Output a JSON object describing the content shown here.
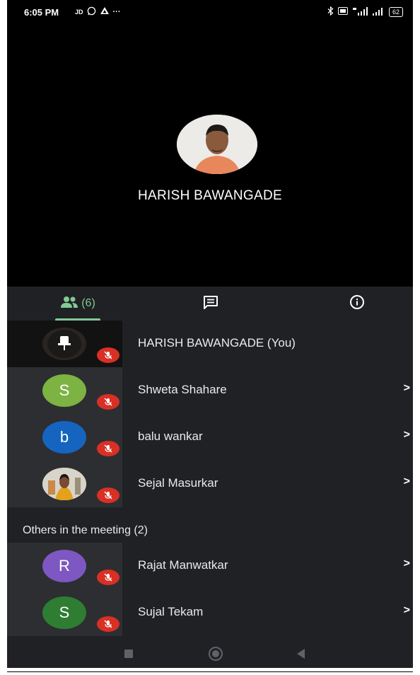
{
  "status_bar": {
    "time": "6:05 PM",
    "left_icons": [
      "jio-icon",
      "whatsapp-icon",
      "drive-icon",
      "more-dots-icon"
    ],
    "carrier_label": "JD",
    "more": "···",
    "right_icons": [
      "bluetooth-icon",
      "volte-icon",
      "signal-4g-icon",
      "signal-icon",
      "battery-icon"
    ],
    "battery": "62"
  },
  "stage": {
    "speaker_name": "HARISH BAWANGADE"
  },
  "tabs": {
    "people_count": "(6)",
    "items": [
      "people-tab",
      "chat-tab",
      "info-tab"
    ]
  },
  "participants": [
    {
      "name": "HARISH BAWANGADE (You)",
      "initial": "",
      "avatar_color": "#1f1f1f",
      "muted": true,
      "chevron": false,
      "kind": "self"
    },
    {
      "name": "Shweta Shahare",
      "initial": "S",
      "avatar_color": "#7cb342",
      "muted": true,
      "chevron": true,
      "kind": "letter"
    },
    {
      "name": "balu wankar",
      "initial": "b",
      "avatar_color": "#1565c0",
      "muted": true,
      "chevron": true,
      "kind": "letter"
    },
    {
      "name": "Sejal Masurkar",
      "initial": "",
      "avatar_color": "#d8d3c7",
      "muted": true,
      "chevron": true,
      "kind": "photo"
    }
  ],
  "others_label": "Others in the meeting (2)",
  "others": [
    {
      "name": "Rajat Manwatkar",
      "initial": "R",
      "avatar_color": "#7e57c2",
      "muted": true,
      "chevron": true
    },
    {
      "name": "Sujal Tekam",
      "initial": "S",
      "avatar_color": "#2e7d32",
      "muted": true,
      "chevron": true
    }
  ],
  "colors": {
    "accent": "#81c995",
    "muted_badge": "#d93025",
    "panel": "#202124",
    "thumb": "#2d2e31"
  }
}
